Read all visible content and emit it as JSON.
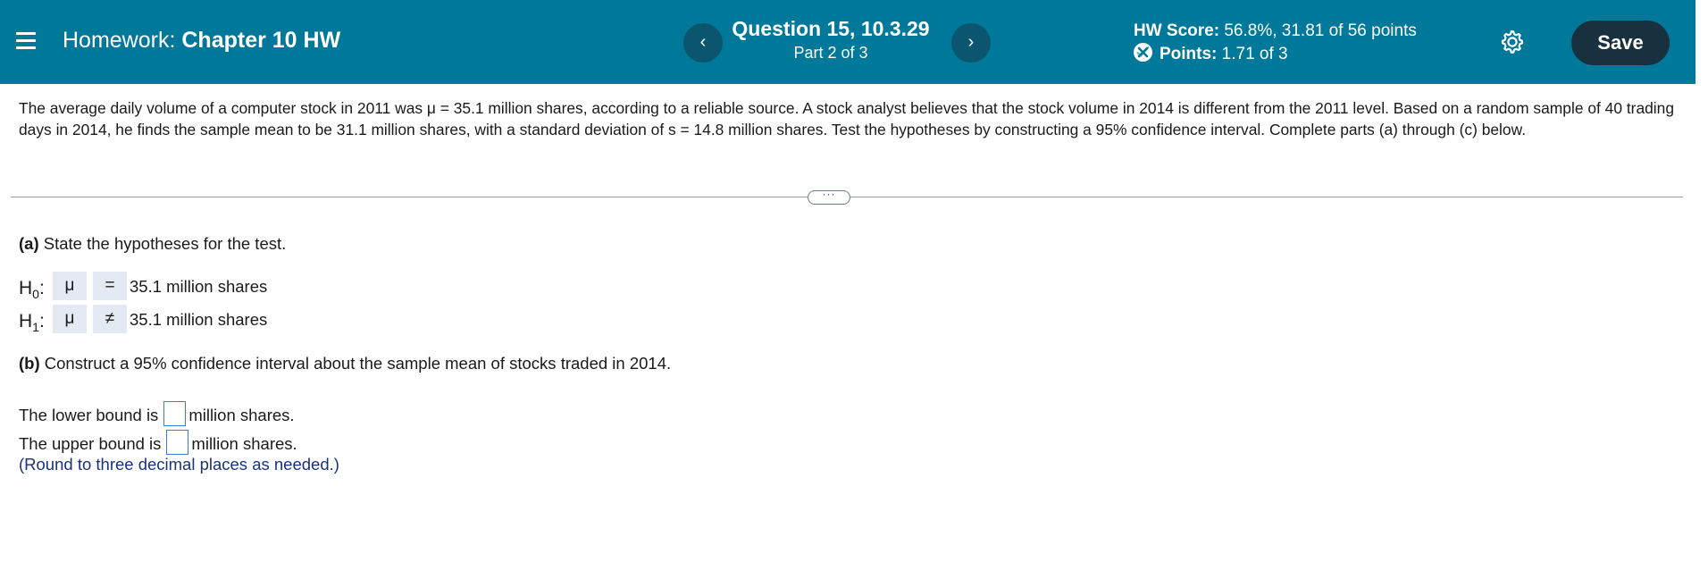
{
  "header": {
    "menu_icon": "hamburger-menu-icon",
    "homework_label": "Homework:",
    "homework_name": "Chapter 10 HW",
    "prev_icon": "chevron-left-icon",
    "next_icon": "chevron-right-icon",
    "prev_glyph": "‹",
    "next_glyph": "›",
    "question_title": "Question 15, 10.3.29",
    "question_part": "Part 2 of 3",
    "score_label": "HW Score:",
    "score_value": "56.8%, 31.81 of 56 points",
    "points_label": "Points:",
    "points_value": "1.71 of 3",
    "points_icon": "partial-credit-icon",
    "settings_icon": "gear-icon",
    "save_label": "Save",
    "colors": {
      "bar": "#00789a",
      "nav_button": "#0b566e",
      "save_button": "#17313f"
    }
  },
  "question": {
    "text": "The average daily volume of a computer stock in 2011 was μ = 35.1 million shares, according to a reliable source. A stock analyst believes that the stock volume in 2014 is different from the 2011 level. Based on a random sample of 40 trading days in 2014, he finds the sample mean to be 31.1 million shares, with a standard deviation of s = 14.8 million shares. Test the hypotheses by constructing a 95% confidence interval. Complete parts (a) through (c) below."
  },
  "divider_handle": "···",
  "part_a": {
    "label": "(a)",
    "text": "State the hypotheses for the test.",
    "h0": {
      "label": "H",
      "sub": "0",
      "colon": ":",
      "param": "μ",
      "op": "=",
      "value": "35.1 million shares"
    },
    "h1": {
      "label": "H",
      "sub": "1",
      "colon": ":",
      "param": "μ",
      "op": "≠",
      "value": "35.1 million shares"
    }
  },
  "part_b": {
    "label": "(b)",
    "text": "Construct a 95% confidence interval about the sample mean of stocks traded in 2014.",
    "lower_prefix": "The lower bound is",
    "lower_value": "",
    "lower_suffix": "million shares.",
    "upper_prefix": "The upper bound is",
    "upper_value": "",
    "upper_suffix": "million shares.",
    "hint": "(Round to three decimal places as needed.)",
    "hint_color": "#1a3278"
  }
}
